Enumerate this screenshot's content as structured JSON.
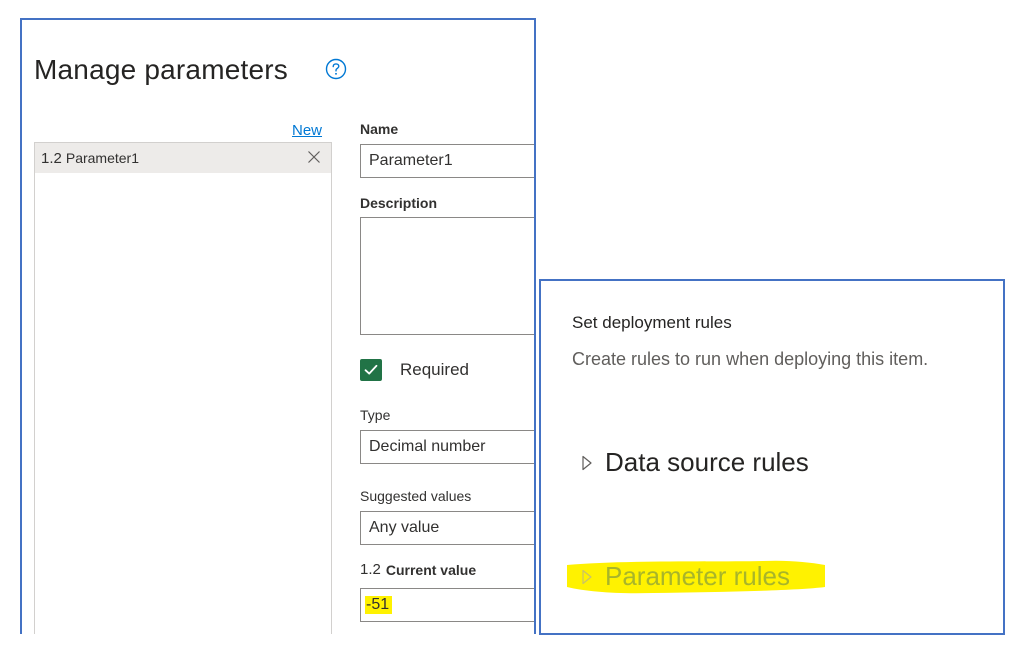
{
  "manage_parameters": {
    "title": "Manage parameters",
    "help_icon": "help-circle-icon",
    "new_link": "New",
    "parameter_list": [
      {
        "type_badge": "1.2",
        "name": "Parameter1",
        "delete_icon": "close-icon"
      }
    ],
    "form": {
      "name_label": "Name",
      "name_value": "Parameter1",
      "description_label": "Description",
      "description_value": "",
      "required_label": "Required",
      "required_checked": true,
      "type_label": "Type",
      "type_value": "Decimal number",
      "suggested_values_label": "Suggested values",
      "suggested_values_value": "Any value",
      "current_value_badge": "1.2",
      "current_value_label": "Current value",
      "current_value": "-51"
    }
  },
  "deployment_rules": {
    "title": "Set deployment rules",
    "subtitle": "Create rules to run when deploying this item.",
    "sections": [
      {
        "label": "Data source rules",
        "icon": "chevron-right-icon"
      },
      {
        "label": "Parameter rules",
        "icon": "chevron-right-icon"
      }
    ]
  },
  "colors": {
    "panel_border": "#4472c4",
    "checkbox_fill": "#217346",
    "link": "#0078d4",
    "highlight": "#fff200"
  }
}
